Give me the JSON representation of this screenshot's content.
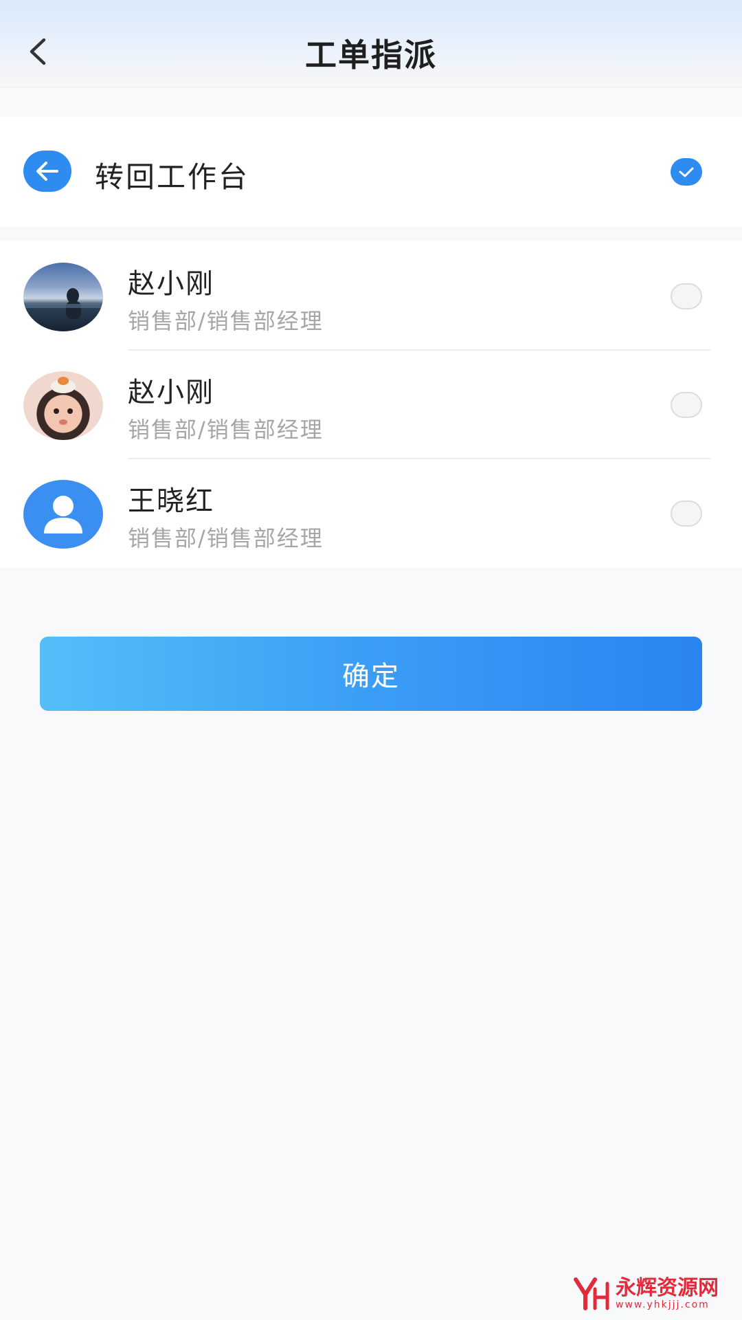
{
  "header": {
    "title": "工单指派",
    "back_icon": "chevron-left-icon"
  },
  "return_option": {
    "label": "转回工作台",
    "icon": "arrow-left-icon",
    "selected": true,
    "accent": "#2e8bf0"
  },
  "staff": [
    {
      "name": "赵小刚",
      "dept": "销售部/销售部经理",
      "avatar": "photo-scenery",
      "selected": false
    },
    {
      "name": "赵小刚",
      "dept": "销售部/销售部经理",
      "avatar": "photo-child",
      "selected": false
    },
    {
      "name": "王晓红",
      "dept": "销售部/销售部经理",
      "avatar": "default-user-icon",
      "selected": false
    }
  ],
  "confirm_label": "确定",
  "watermark": {
    "title": "永辉资源网",
    "url": "www.yhkjjj.com",
    "color": "#e22b3a"
  }
}
